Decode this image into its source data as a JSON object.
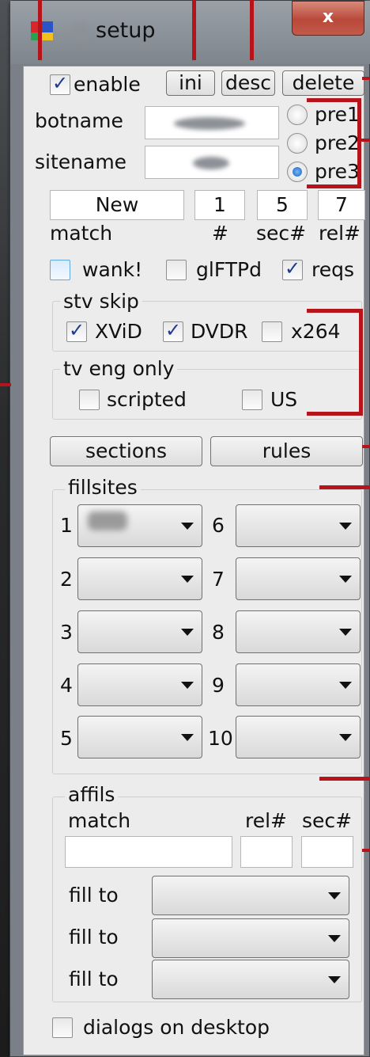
{
  "window": {
    "title": "setup",
    "close_label": "x"
  },
  "top": {
    "enable_label": "enable",
    "enable_checked": true,
    "buttons": [
      "ini",
      "desc",
      "delete"
    ]
  },
  "fields": {
    "botname_label": "botname",
    "sitename_label": "sitename"
  },
  "pre": {
    "options": [
      "pre1",
      "pre2",
      "pre3"
    ],
    "selected": "pre3"
  },
  "match_row": {
    "values": [
      "New",
      "1",
      "5",
      "7"
    ],
    "labels": [
      "match",
      "#",
      "sec#",
      "rel#"
    ]
  },
  "options_row": [
    {
      "label": "wank!",
      "checked": false
    },
    {
      "label": "glFTPd",
      "checked": false
    },
    {
      "label": "reqs",
      "checked": true
    }
  ],
  "stv_skip": {
    "title": "stv skip",
    "items": [
      {
        "label": "XViD",
        "checked": true
      },
      {
        "label": "DVDR",
        "checked": true
      },
      {
        "label": "x264",
        "checked": false
      }
    ]
  },
  "tv_eng": {
    "title": "tv eng only",
    "items": [
      {
        "label": "scripted",
        "checked": false
      },
      {
        "label": "US",
        "checked": false
      }
    ]
  },
  "action_buttons": [
    "sections",
    "rules"
  ],
  "fillsites": {
    "title": "fillsites",
    "numbers": [
      "1",
      "2",
      "3",
      "4",
      "5",
      "6",
      "7",
      "8",
      "9",
      "10"
    ]
  },
  "affils": {
    "title": "affils",
    "match_label": "match",
    "rel_label": "rel#",
    "sec_label": "sec#",
    "fill_labels": [
      "fill to",
      "fill to",
      "fill to"
    ]
  },
  "bottom": {
    "dialogs_label": "dialogs on desktop",
    "dialogs_checked": false
  },
  "colors": {
    "annotation": "#b5141b",
    "accent_check": "#1d3a8f"
  }
}
